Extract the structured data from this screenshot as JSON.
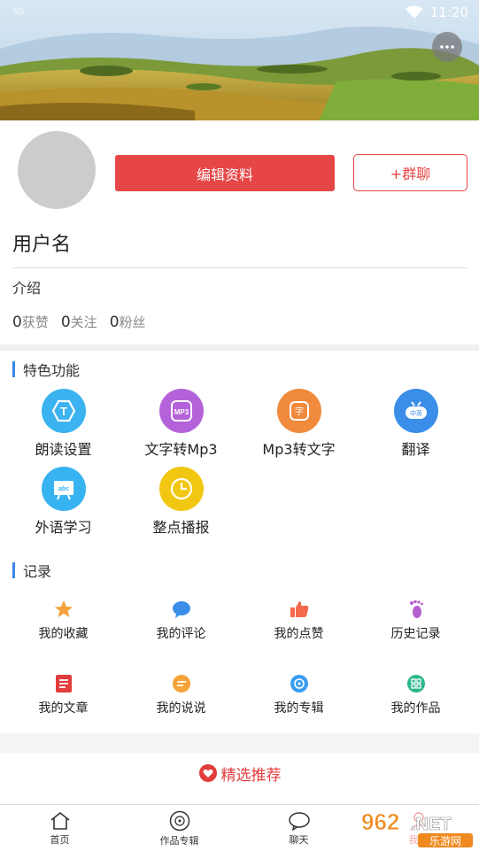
{
  "status_bar": {
    "left_text": "SG",
    "time": "11:20",
    "wifi_icon": "wifi-icon"
  },
  "header": {
    "more_icon": "more-dots-icon"
  },
  "profile": {
    "edit_button": "编辑资料",
    "group_chat_button": "+群聊",
    "username": "用户名",
    "intro": "介绍",
    "stats": [
      {
        "num": "0",
        "label": "获赞"
      },
      {
        "num": "0",
        "label": "关注"
      },
      {
        "num": "0",
        "label": "粉丝"
      }
    ]
  },
  "features": {
    "title": "特色功能",
    "items": [
      {
        "label": "朗读设置",
        "icon": "text-tts-icon",
        "color": "#3bb3f0",
        "glyph": "T"
      },
      {
        "label": "文字转Mp3",
        "icon": "mp3-icon",
        "color": "#b462d9",
        "glyph": "MP3"
      },
      {
        "label": "Mp3转文字",
        "icon": "text-char-icon",
        "color": "#f08a3c",
        "glyph": "字"
      },
      {
        "label": "翻译",
        "icon": "translate-icon",
        "color": "#3a8ee8",
        "glyph": "中英"
      },
      {
        "label": "外语学习",
        "icon": "language-board-icon",
        "color": "#36b3f0",
        "glyph": "abc"
      },
      {
        "label": "整点播报",
        "icon": "clock-icon",
        "color": "#f2c712",
        "glyph": ""
      }
    ]
  },
  "records": {
    "title": "记录",
    "items": [
      {
        "label": "我的收藏",
        "icon": "star-icon",
        "color": "#f4a23c"
      },
      {
        "label": "我的评论",
        "icon": "comment-icon",
        "color": "#3a8ee8"
      },
      {
        "label": "我的点赞",
        "icon": "thumbs-up-icon",
        "color": "#f26a4a"
      },
      {
        "label": "历史记录",
        "icon": "footprint-icon",
        "color": "#b35fd0"
      },
      {
        "label": "我的文章",
        "icon": "article-icon",
        "color": "#e23c3c"
      },
      {
        "label": "我的说说",
        "icon": "message-icon",
        "color": "#f5a236"
      },
      {
        "label": "我的专辑",
        "icon": "album-icon",
        "color": "#3a9ef0"
      },
      {
        "label": "我的作品",
        "icon": "works-grid-icon",
        "color": "#2ab68c"
      }
    ]
  },
  "featured": {
    "label": "精选推荐",
    "icon": "heart-icon",
    "color": "#e23c3c"
  },
  "bottom_nav": {
    "items": [
      {
        "label": "首页",
        "icon": "home-icon"
      },
      {
        "label": "作品专辑",
        "icon": "disc-icon"
      },
      {
        "label": "聊天",
        "icon": "chat-bubble-icon"
      },
      {
        "label": "我的",
        "icon": "profile-icon"
      }
    ]
  },
  "watermark": {
    "brand": "962.NET",
    "sub": "乐游网"
  }
}
